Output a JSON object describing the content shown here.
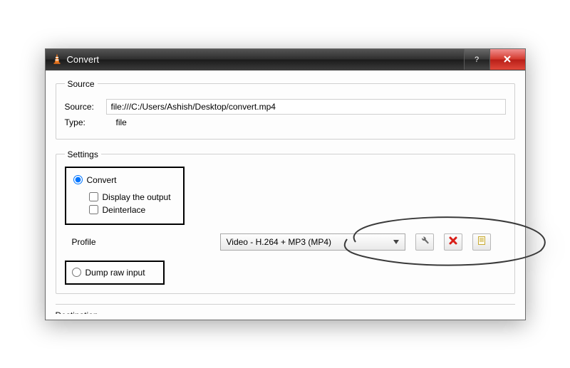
{
  "window": {
    "title": "Convert"
  },
  "source_group": {
    "legend": "Source",
    "source_label": "Source:",
    "source_value": "file:///C:/Users/Ashish/Desktop/convert.mp4",
    "type_label": "Type:",
    "type_value": "file"
  },
  "settings_group": {
    "legend": "Settings",
    "convert_radio": "Convert",
    "display_output": "Display the output",
    "deinterlace": "Deinterlace",
    "profile_label": "Profile",
    "profile_selected": "Video - H.264 + MP3 (MP4)",
    "dump_radio": "Dump raw input"
  },
  "destination_group": {
    "legend": "Destination"
  }
}
